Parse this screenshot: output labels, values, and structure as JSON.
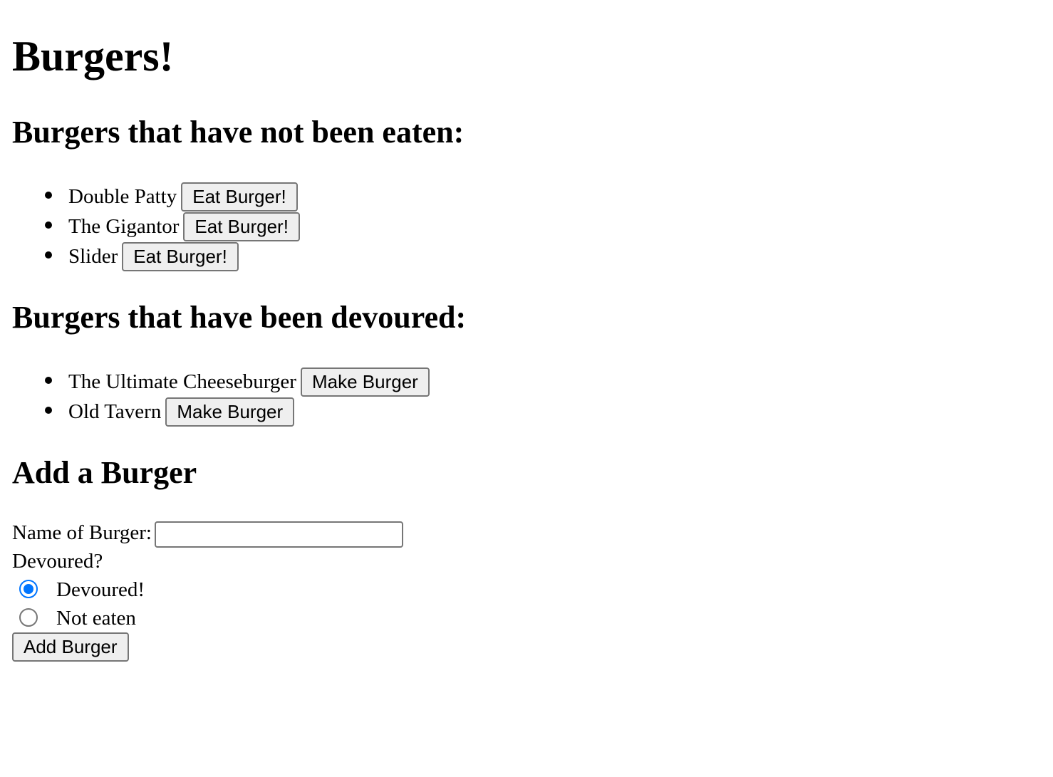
{
  "page": {
    "title": "Burgers!"
  },
  "not_eaten": {
    "heading": "Burgers that have not been eaten:",
    "button_label": "Eat Burger!",
    "items": [
      {
        "name": "Double Patty"
      },
      {
        "name": "The Gigantor"
      },
      {
        "name": "Slider"
      }
    ]
  },
  "devoured": {
    "heading": "Burgers that have been devoured:",
    "button_label": "Make Burger",
    "items": [
      {
        "name": "The Ultimate Cheeseburger"
      },
      {
        "name": "Old Tavern"
      }
    ]
  },
  "add_form": {
    "heading": "Add a Burger",
    "name_label": "Name of Burger:",
    "name_value": "",
    "devoured_label": "Devoured?",
    "options": [
      {
        "label": "Devoured!",
        "checked": true
      },
      {
        "label": "Not eaten",
        "checked": false
      }
    ],
    "submit_label": "Add Burger"
  },
  "colors": {
    "radio_accent": "#0075ff",
    "button_bg": "#efefef",
    "border": "#767676"
  }
}
